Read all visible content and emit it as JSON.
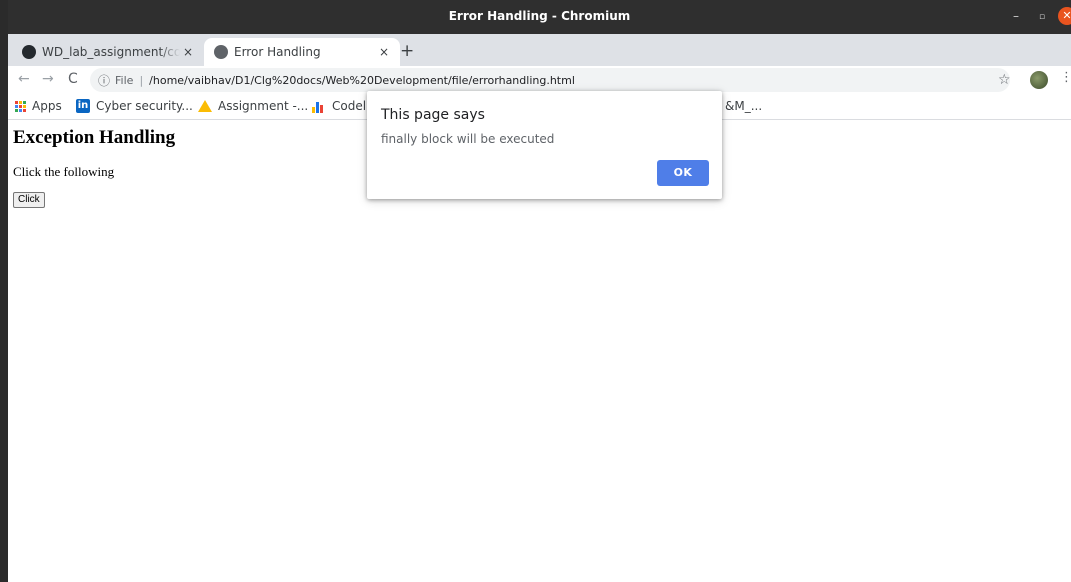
{
  "window": {
    "title": "Error Handling - Chromium",
    "controls": {
      "minimize": "–",
      "maximize": "▫",
      "close": "✕"
    }
  },
  "tabs": [
    {
      "label": "WD_lab_assignment/cool",
      "icon": "github-icon",
      "close": "×",
      "active": false
    },
    {
      "label": "Error Handling",
      "icon": "globe-icon",
      "close": "×",
      "active": true
    }
  ],
  "new_tab": "+",
  "toolbar": {
    "back": "←",
    "forward": "→",
    "reload": "C",
    "info": "ⓘ",
    "scheme": "File",
    "separator": "|",
    "url": "/home/vaibhav/D1/Clg%20docs/Web%20Development/file/errorhandling.html",
    "star": "☆",
    "menu": "⋮"
  },
  "bookmarks": [
    {
      "label": "Apps",
      "icon": "apps-grid-icon"
    },
    {
      "label": "Cyber security...",
      "icon": "linkedin-icon"
    },
    {
      "label": "Assignment -...",
      "icon": "google-drive-icon"
    },
    {
      "label": "Codel",
      "icon": "bar-chart-icon"
    },
    {
      "label": "&M_...",
      "icon": ""
    }
  ],
  "page": {
    "heading": "Exception Handling",
    "text": "Click the following",
    "button_label": "Click"
  },
  "dialog": {
    "title": "This page says",
    "message": "finally block will be executed",
    "ok_label": "OK"
  },
  "colors": {
    "titlebar": "#2f2f2f",
    "tabstrip": "#dee1e6",
    "close_button": "#e9541f",
    "ok_button": "#4f7ee8",
    "linkedin": "#0a66c2"
  }
}
